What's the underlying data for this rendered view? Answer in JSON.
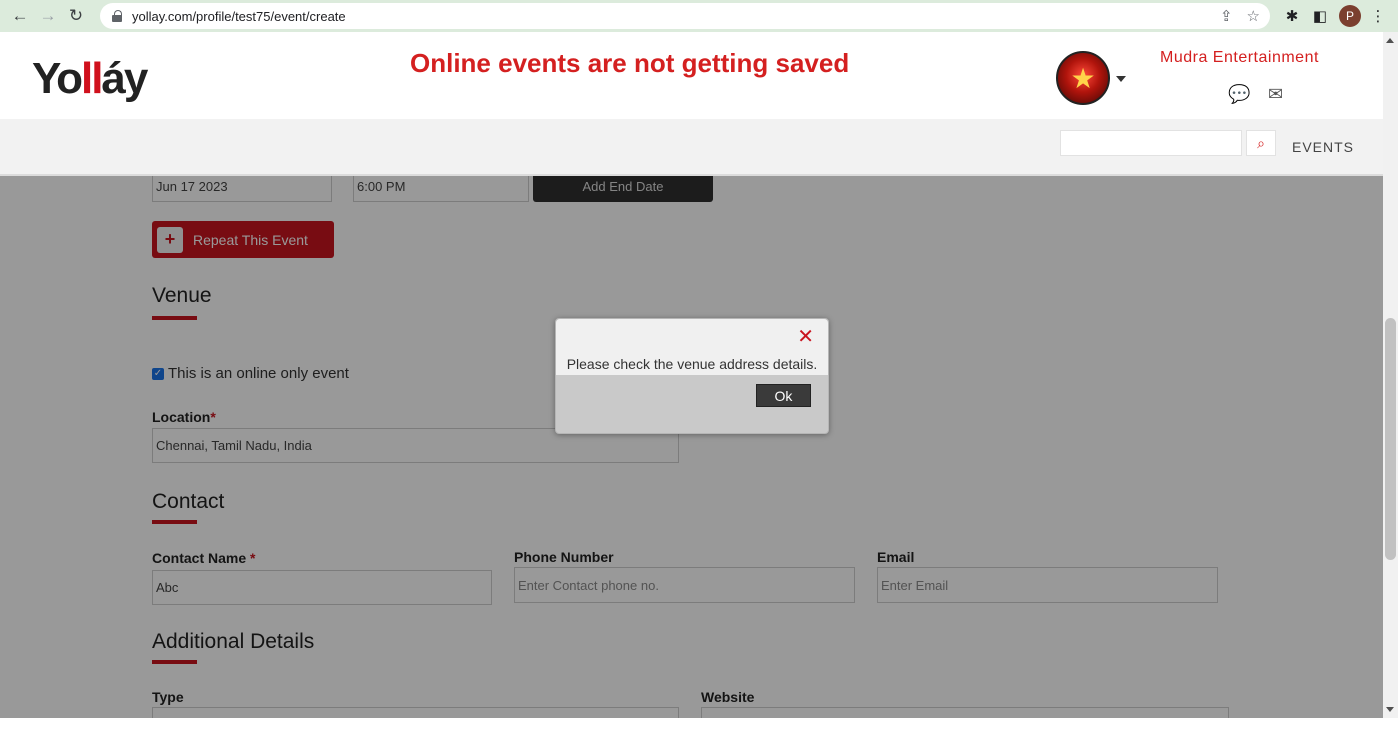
{
  "browser": {
    "url": "yollay.com/profile/test75/event/create",
    "profile_initial": "P"
  },
  "header": {
    "logo_part1": "Yo",
    "logo_part2": "ll",
    "logo_part3": "áy",
    "banner": "Online events are not getting saved",
    "org_name": "Mudra Entertainment"
  },
  "subbar": {
    "search_placeholder": "",
    "events_label": "EVENTS"
  },
  "form": {
    "date_value": "Jun 17 2023",
    "time_value": "6:00 PM",
    "add_end_date_label": "Add End Date",
    "repeat_label": "Repeat This Event",
    "venue_title": "Venue",
    "online_only_label": "This is an online only event",
    "location_label": "Location",
    "location_value": "Chennai, Tamil Nadu, India",
    "contact_title": "Contact",
    "contact_name_label": "Contact Name",
    "contact_name_value": "Abc",
    "phone_label": "Phone Number",
    "phone_placeholder": "Enter Contact phone no.",
    "email_label": "Email",
    "email_placeholder": "Enter Email",
    "additional_title": "Additional Details",
    "type_label": "Type",
    "website_label": "Website",
    "required_mark": "*"
  },
  "modal": {
    "message": "Please check the venue address details.",
    "ok_label": "Ok",
    "close_glyph": "✕"
  },
  "colors": {
    "brand_red": "#c9141f",
    "banner_red": "#d42020"
  }
}
